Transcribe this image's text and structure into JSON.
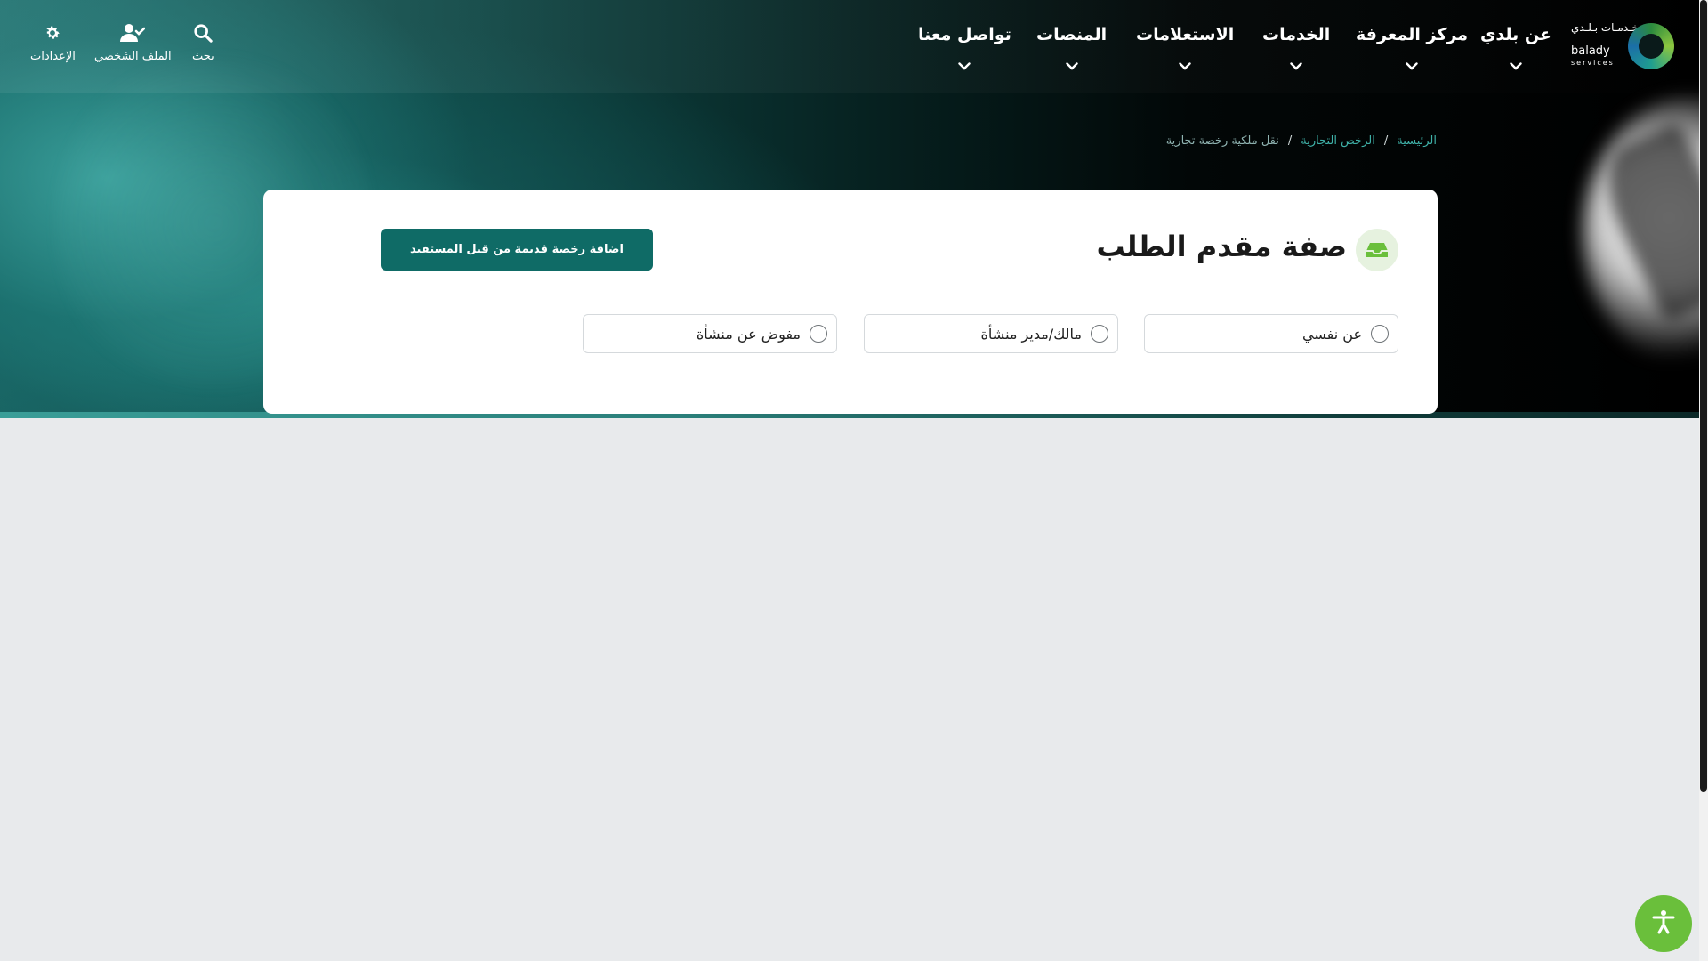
{
  "header": {
    "logo": {
      "arabic": "خـدمـات بـلـدي",
      "english": "balady",
      "sub": "services"
    },
    "nav": [
      {
        "label": "عن بلدي"
      },
      {
        "label": "مركز المعرفة"
      },
      {
        "label": "الخدمات"
      },
      {
        "label": "الاستعلامات"
      },
      {
        "label": "المنصات"
      },
      {
        "label": "تواصل معنا"
      }
    ],
    "utilities": {
      "search": "بحث",
      "profile": "الملف الشخصي",
      "settings": "الإعدادات"
    }
  },
  "breadcrumb": {
    "home": "الرئيسية",
    "section": "الرخص التجارية",
    "current": "نقل ملكية رخصة تجارية",
    "separator": "/"
  },
  "card": {
    "title": "صفة مقدم الطلب",
    "add_button": "اضافة رخصة قديمة من قبل المستفيد",
    "options": [
      {
        "label": "عن نفسي"
      },
      {
        "label": "مالك/مدير منشأة"
      },
      {
        "label": "مفوض عن منشأة"
      }
    ]
  },
  "colors": {
    "primary": "#0f6b66",
    "accent_green": "#6abf3b",
    "link": "#3fb1a8",
    "page_bg": "#e8eaec"
  },
  "icons": {
    "search": "search-icon",
    "profile": "user-check-icon",
    "settings": "gear-icon",
    "title": "inbox-tray-icon",
    "accessibility": "accessibility-icon"
  }
}
